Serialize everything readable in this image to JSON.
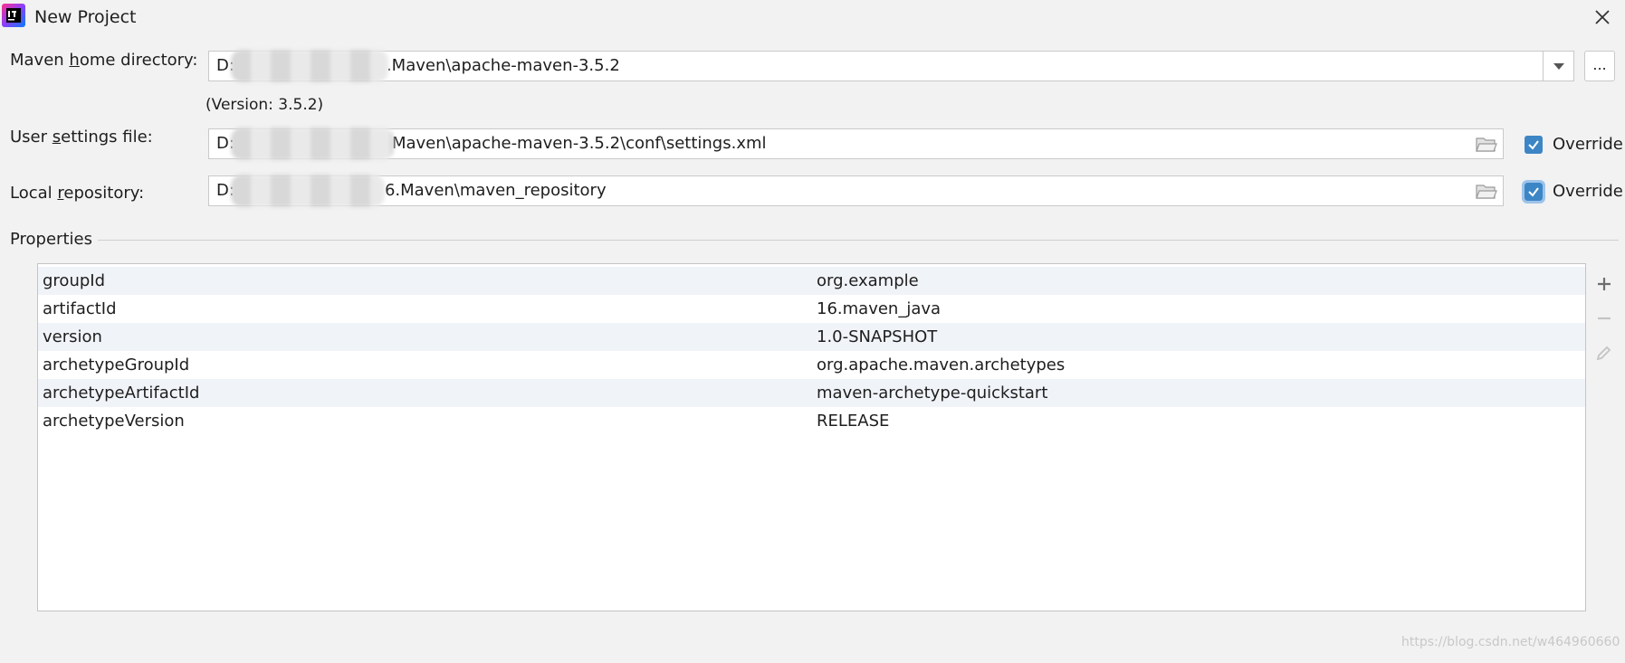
{
  "window": {
    "title": "New Project"
  },
  "maven_home": {
    "label_pre": "Maven ",
    "label_mnemonic": "h",
    "label_post": "ome directory:",
    "value_prefix": "D:",
    "value_suffix": ".Maven\\apache-maven-3.5.2",
    "browse_label": "...",
    "version_text": "(Version: 3.5.2)"
  },
  "user_settings": {
    "label_pre": "User ",
    "label_mnemonic": "s",
    "label_post": "ettings file:",
    "value_prefix": "D:",
    "value_suffix": "Maven\\apache-maven-3.5.2\\conf\\settings.xml",
    "override_label": "Override",
    "override_checked": true
  },
  "local_repository": {
    "label_pre": "Local ",
    "label_mnemonic": "r",
    "label_post": "epository:",
    "value_prefix": "D:",
    "value_suffix": "6.Maven\\maven_repository",
    "override_label": "Override",
    "override_checked": true
  },
  "properties": {
    "label": "Properties",
    "rows": [
      {
        "key": "groupId",
        "value": "org.example"
      },
      {
        "key": "artifactId",
        "value": "16.maven_java"
      },
      {
        "key": "version",
        "value": "1.0-SNAPSHOT"
      },
      {
        "key": "archetypeGroupId",
        "value": "org.apache.maven.archetypes"
      },
      {
        "key": "archetypeArtifactId",
        "value": "maven-archetype-quickstart"
      },
      {
        "key": "archetypeVersion",
        "value": "RELEASE"
      }
    ]
  },
  "watermark": "https://blog.csdn.net/w464960660",
  "colors": {
    "checkbox": "#3d86c6",
    "row_alt": "#f0f3f8"
  }
}
